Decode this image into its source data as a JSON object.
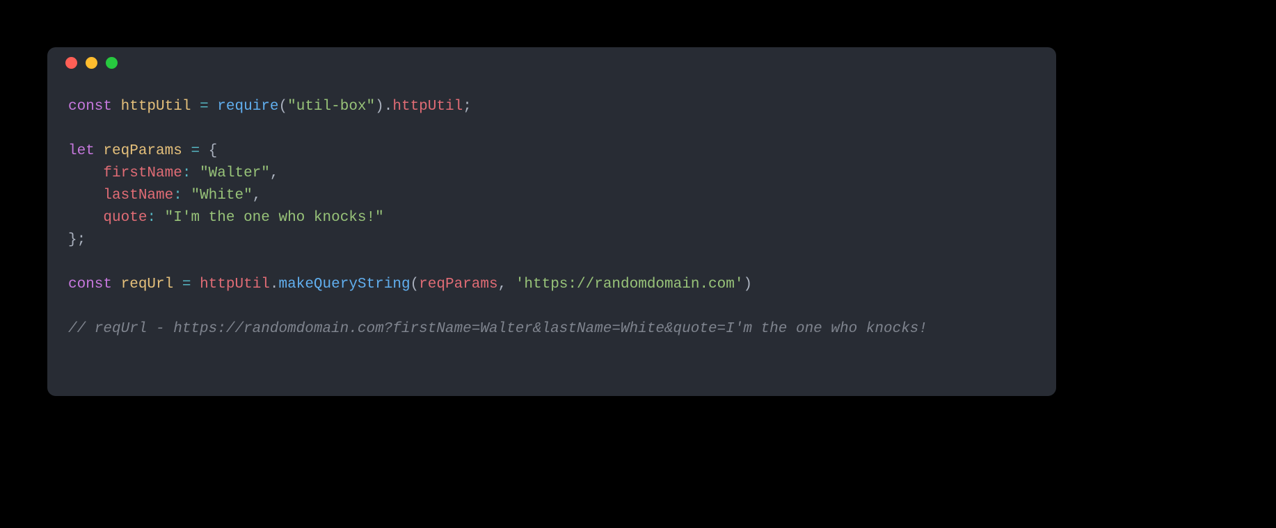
{
  "code": {
    "l1": {
      "kw_const": "const",
      "sp1": " ",
      "var_httpUtil": "httpUtil",
      "sp2": " ",
      "eq": "=",
      "sp3": " ",
      "fn_require": "require",
      "lp": "(",
      "str_module": "\"util-box\"",
      "rp": ")",
      "dot": ".",
      "prop_httpUtil": "httpUtil",
      "semi": ";"
    },
    "l2": "",
    "l3": {
      "kw_let": "let",
      "sp1": " ",
      "var_reqParams": "reqParams",
      "sp2": " ",
      "eq": "=",
      "sp3": " ",
      "brace": "{"
    },
    "l4": {
      "indent": "    ",
      "prop": "firstName",
      "colon": ":",
      "sp": " ",
      "str": "\"Walter\"",
      "comma": ","
    },
    "l5": {
      "indent": "    ",
      "prop": "lastName",
      "colon": ":",
      "sp": " ",
      "str": "\"White\"",
      "comma": ","
    },
    "l6": {
      "indent": "    ",
      "prop": "quote",
      "colon": ":",
      "sp": " ",
      "str": "\"I'm the one who knocks!\""
    },
    "l7": {
      "close": "};"
    },
    "l8": "",
    "l9": {
      "kw_const": "const",
      "sp1": " ",
      "var_reqUrl": "reqUrl",
      "sp2": " ",
      "eq": "=",
      "sp3": " ",
      "obj": "httpUtil",
      "dot": ".",
      "method": "makeQueryString",
      "lp": "(",
      "arg1": "reqParams",
      "comma": ",",
      "sp4": " ",
      "str_url": "'https://randomdomain.com'",
      "rp": ")"
    },
    "l10": "",
    "l11": {
      "comment": "// reqUrl - https://randomdomain.com?firstName=Walter&lastName=White&quote=I'm the one who knocks!"
    }
  }
}
